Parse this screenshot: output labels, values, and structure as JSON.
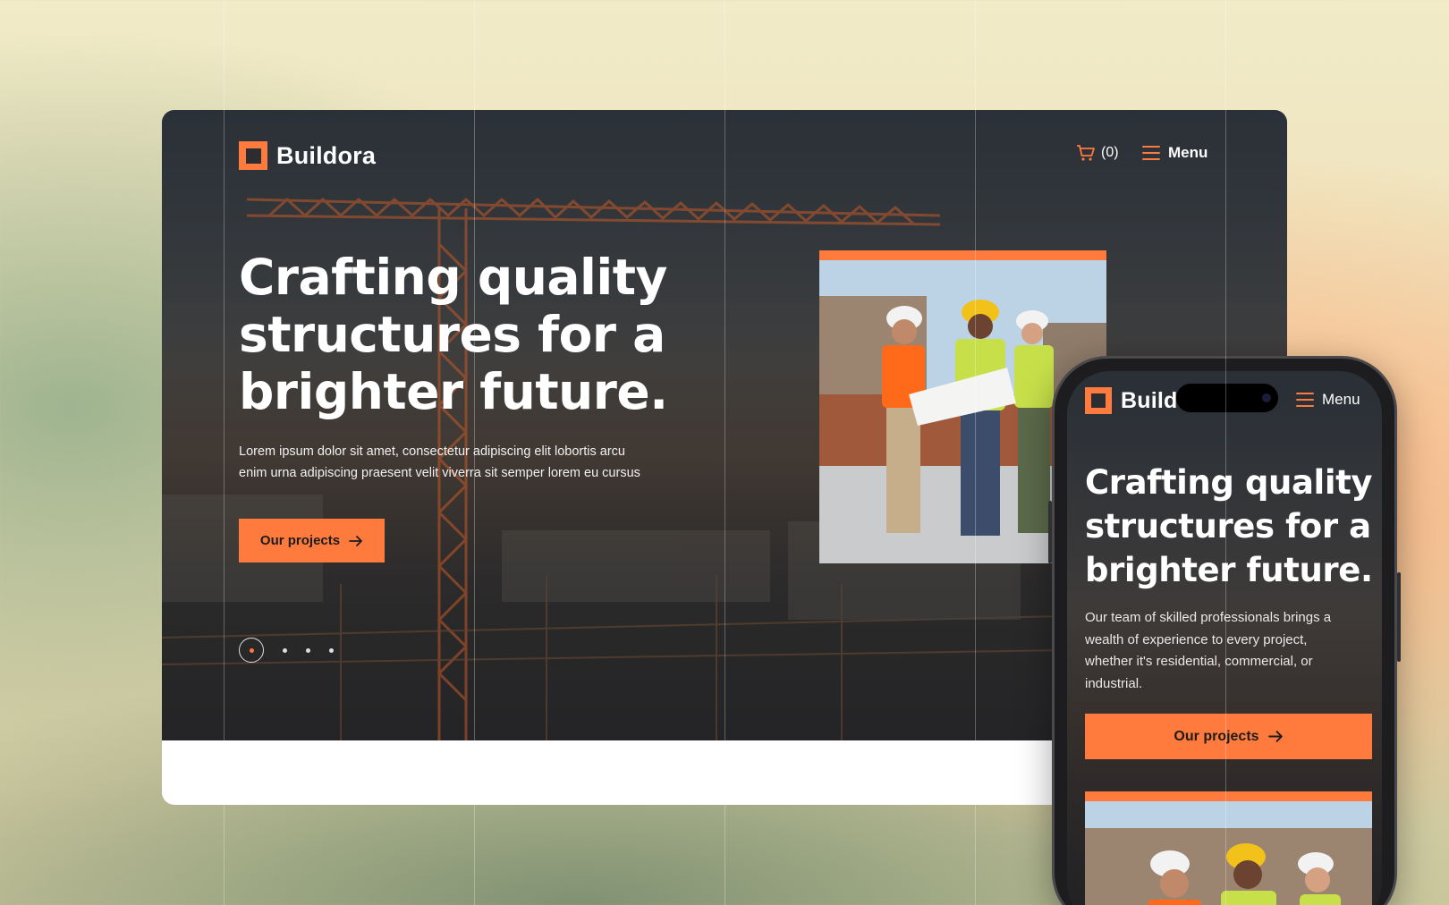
{
  "brand": {
    "name": "Buildora",
    "accent": "#ff7a3d"
  },
  "desktop": {
    "header": {
      "cart_count": "(0)",
      "menu_label": "Menu"
    },
    "hero": {
      "headline_lines": [
        "Crafting quality",
        "structures for a",
        "brighter future."
      ],
      "lead_lines": [
        "Lorem ipsum dolor sit amet, consectetur adipiscing elit lobortis arcu",
        "enim urna adipiscing praesent velit viverra sit semper lorem eu cursus"
      ],
      "cta_label": "Our projects",
      "slides": {
        "total": 4,
        "active": 1
      }
    }
  },
  "mobile": {
    "header": {
      "brand_visible": "Builde",
      "menu_label": "Menu"
    },
    "hero": {
      "headline_lines": [
        "Crafting quality",
        "structures for a",
        "brighter future."
      ],
      "lead": "Our team of skilled professionals brings a wealth of experience to every project, whether it's residential, commercial, or industrial.",
      "cta_label": "Our projects"
    }
  },
  "icons": {
    "cart": "cart-icon",
    "menu": "hamburger-icon",
    "arrow": "arrow-right-icon"
  }
}
